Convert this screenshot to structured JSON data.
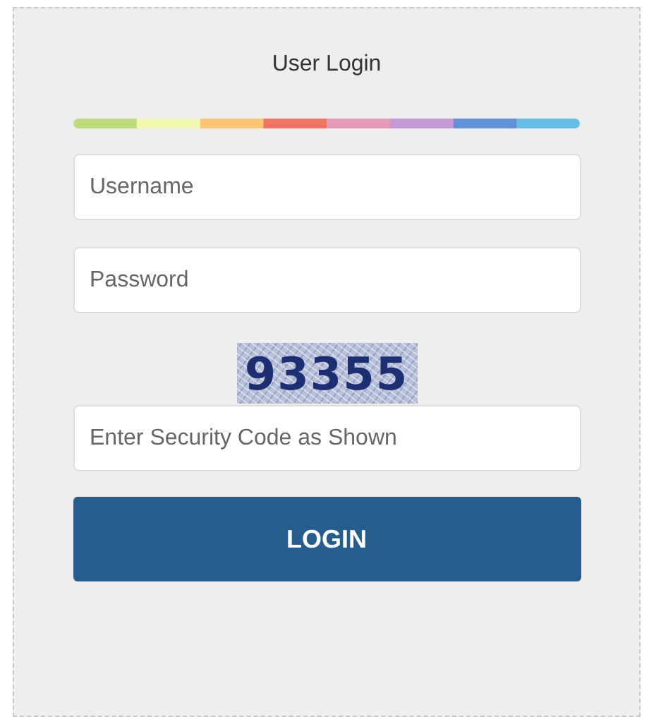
{
  "title": "User Login",
  "fields": [
    {
      "placeholder": "Username"
    },
    {
      "placeholder": "Password"
    }
  ],
  "captcha": {
    "code": "93355"
  },
  "security_field": {
    "placeholder": "Enter Security Code as Shown"
  },
  "login_button": "LOGIN"
}
